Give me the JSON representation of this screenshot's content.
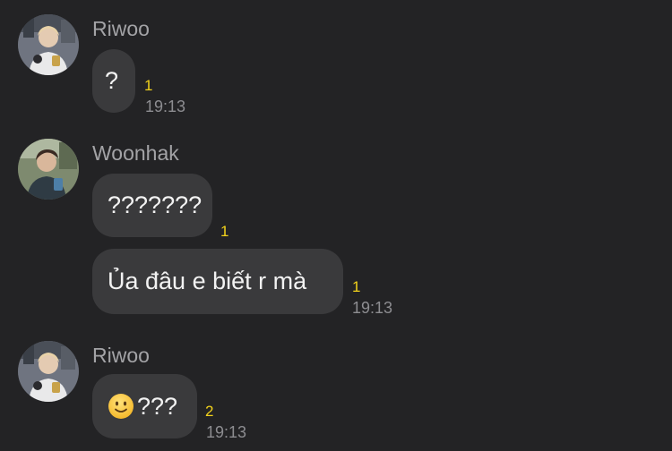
{
  "messages": [
    {
      "sender": "Riwoo",
      "avatar_icon": "riwoo-avatar-photo",
      "bubbles": [
        {
          "text": "?",
          "unread": "1",
          "time": "19:13"
        }
      ]
    },
    {
      "sender": "Woonhak",
      "avatar_icon": "woonhak-avatar-photo",
      "bubbles": [
        {
          "text": "???????",
          "unread": "1",
          "time": ""
        },
        {
          "text": "Ủa đâu e biết r mà",
          "unread": "1",
          "time": "19:13"
        }
      ]
    },
    {
      "sender": "Riwoo",
      "avatar_icon": "riwoo-avatar-photo",
      "bubbles": [
        {
          "emoji": "slightly-smiling-face-emoji",
          "text": "???",
          "unread": "2",
          "time": "19:13"
        }
      ]
    }
  ],
  "colors": {
    "background": "#232325",
    "bubble": "#3a3a3c",
    "unread_count": "#f2d21b",
    "timestamp": "#8d8d91",
    "sender_name": "#a3a3a6"
  }
}
